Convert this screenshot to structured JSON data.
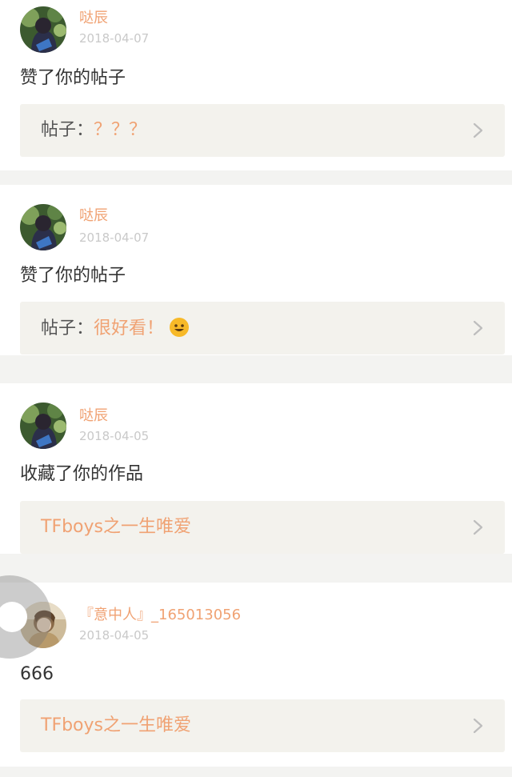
{
  "notifications": [
    {
      "username": "哒辰",
      "date": "2018-04-07",
      "action": "赞了你的帖子",
      "ref_prefix": "帖子：",
      "ref_title": "？？？",
      "avatar": "avatar-girl-green-background",
      "has_emoji": false
    },
    {
      "username": "哒辰",
      "date": "2018-04-07",
      "action": "赞了你的帖子",
      "ref_prefix": "帖子：",
      "ref_title": "很好看！",
      "avatar": "avatar-girl-green-background",
      "has_emoji": true,
      "emoji": "smiling-face-emoji"
    },
    {
      "username": "哒辰",
      "date": "2018-04-05",
      "action": "收藏了你的作品",
      "ref_prefix": "",
      "ref_title": "TFboys之一生唯爱",
      "avatar": "avatar-girl-green-background",
      "has_emoji": false
    },
    {
      "username": "『意中人』_165013056",
      "date": "2018-04-05",
      "action": "666",
      "ref_prefix": "",
      "ref_title": "TFboys之一生唯爱",
      "avatar": "avatar-person-warm-tones",
      "has_emoji": false
    }
  ],
  "colors": {
    "accent": "#f0a273",
    "date": "#c9c9c9",
    "text": "#333333",
    "ref_background": "#f3f2ed",
    "page_background": "#f3f3f1"
  },
  "icons": {
    "chevron": "chevron-right-icon",
    "floating_button": "assistive-touch-button"
  }
}
